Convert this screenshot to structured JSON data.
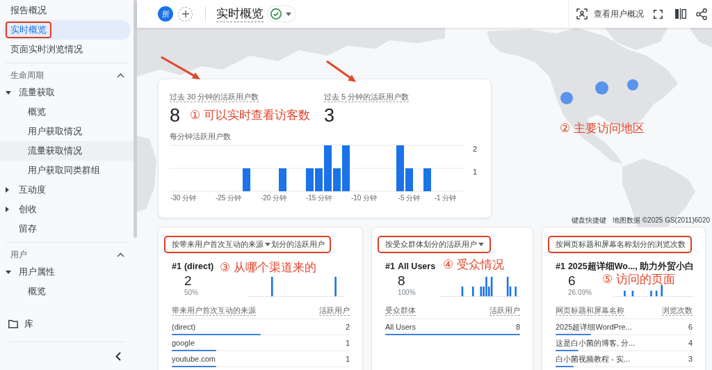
{
  "sidebar": {
    "items": [
      {
        "label": "报告概况",
        "selected": false,
        "highlighted": false
      },
      {
        "label": "实时概览",
        "selected": true,
        "highlighted": true
      },
      {
        "label": "页面实时浏览情况",
        "selected": false,
        "highlighted": false
      }
    ],
    "sections": [
      {
        "title": "生命周期",
        "expanded": true,
        "groups": [
          {
            "label": "流量获取",
            "kind": "group",
            "expanded": true,
            "children": [
              {
                "label": "概览",
                "hovered": false
              },
              {
                "label": "用户获取情况",
                "hovered": false
              },
              {
                "label": "流量获取情况",
                "hovered": true
              },
              {
                "label": "用户获取同类群组",
                "hovered": false
              }
            ]
          },
          {
            "label": "互动度",
            "kind": "group",
            "expanded": false
          },
          {
            "label": "创收",
            "kind": "group",
            "expanded": false
          },
          {
            "label": "留存",
            "kind": "link"
          }
        ]
      },
      {
        "title": "用户",
        "expanded": true,
        "groups": [
          {
            "label": "用户属性",
            "kind": "group",
            "expanded": true,
            "children": [
              {
                "label": "概览",
                "hovered": false
              }
            ]
          }
        ]
      }
    ],
    "footer": {
      "label": "库"
    }
  },
  "header": {
    "badge": "所",
    "title": "实时概览",
    "action": "查看用户概况"
  },
  "realtime_card": {
    "metrics": [
      {
        "label": "过去 30 分钟的活跃用户数",
        "value": "8",
        "annotation": "① 可以实时查看访客数"
      },
      {
        "label": "过去 5 分钟的活跃用户数",
        "value": "3"
      }
    ],
    "chart_data": {
      "type": "bar",
      "title": "每分钟活跃用户数",
      "x": [
        -30,
        -29,
        -28,
        -27,
        -26,
        -25,
        -24,
        -23,
        -22,
        -21,
        -20,
        -19,
        -18,
        -17,
        -16,
        -15,
        -14,
        -13,
        -12,
        -11,
        -10,
        -9,
        -8,
        -7,
        -6,
        -5,
        -4,
        -3,
        -2,
        -1
      ],
      "values": [
        0,
        0,
        0,
        0,
        0,
        0,
        0,
        1,
        0,
        0,
        0,
        1,
        0,
        0,
        1,
        1,
        2,
        1,
        2,
        0,
        0,
        0,
        0,
        0,
        2,
        1,
        0,
        1,
        0,
        0
      ],
      "xlim": [
        -31.5,
        1
      ],
      "ylim": [
        0,
        2
      ],
      "yticks": [
        1,
        2
      ],
      "xticks": [
        {
          "value": -30,
          "label": "-30 分钟"
        },
        {
          "value": -25,
          "label": "-25 分钟"
        },
        {
          "value": -20,
          "label": "-20 分钟"
        },
        {
          "value": -15,
          "label": "-15 分钟"
        },
        {
          "value": -10,
          "label": "-10 分钟"
        },
        {
          "value": -5,
          "label": "-5 分钟"
        },
        {
          "value": -1,
          "label": "-1 分钟"
        }
      ]
    }
  },
  "map": {
    "annotation": "② 主要访问地区",
    "attribution": [
      "键盘快捷键",
      "地图数据 ©2025 GS(2011)6020"
    ]
  },
  "cards": [
    {
      "title": [
        {
          "text": "按带来用户首次互动的来源",
          "dropdown": true
        },
        {
          "text": "划分的活跃用户",
          "dropdown": false
        }
      ],
      "highlighted": true,
      "top": {
        "rank": "#1",
        "name": "(direct)",
        "value": "2",
        "share": "50%"
      },
      "annotation": "③ 从哪个渠道来的",
      "columns": [
        "带来用户首次互动的来源",
        "活跃用户"
      ],
      "rows": [
        {
          "name": "(direct)",
          "value": "2",
          "level": 0.5
        },
        {
          "name": "google",
          "value": "1",
          "level": 0.25
        },
        {
          "name": "youtube.com",
          "value": "1",
          "level": 0.25
        }
      ]
    },
    {
      "title": [
        {
          "text": "按受众群体划分的活跃用户",
          "dropdown": true
        }
      ],
      "highlighted": true,
      "top": {
        "rank": "#1",
        "name": "All Users",
        "value": "8",
        "share": "100%"
      },
      "annotation": "④ 受众情况",
      "columns": [
        "受众群体",
        "活跃用户"
      ],
      "rows": [
        {
          "name": "All Users",
          "value": "8",
          "level": 1
        }
      ]
    },
    {
      "title": [
        {
          "text": "按网页标题和屏幕名称划分的浏览次数",
          "dropdown": false
        }
      ],
      "highlighted": true,
      "top": {
        "rank": "#1",
        "name": "2025超详细Wo..., 助力外贸小白",
        "value": "6",
        "share": "26.09%"
      },
      "annotation": "⑤ 访问的页面",
      "columns": [
        "网页标题和屏幕名称",
        "浏览次数"
      ],
      "rows": [
        {
          "name": "2025超详细WordPre...",
          "value": "6",
          "level": 0.26
        },
        {
          "name": "这是白小菌的博客, 分...",
          "value": "4",
          "level": 0.17
        },
        {
          "name": "白小菌视频教程 - 实...",
          "value": "3",
          "level": 0.13
        }
      ]
    }
  ]
}
